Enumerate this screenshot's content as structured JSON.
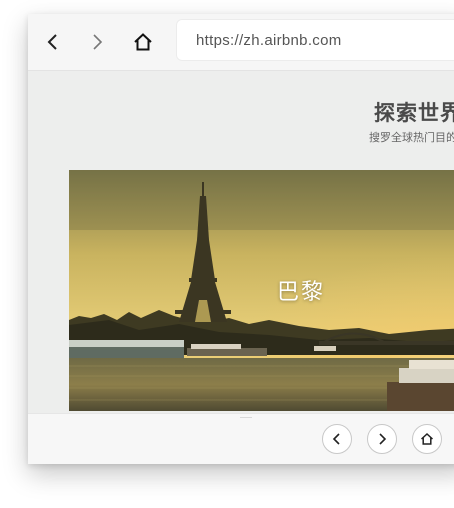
{
  "browser": {
    "url": "https://zh.airbnb.com",
    "back_icon": "chevron-left-icon",
    "forward_icon": "chevron-right-icon",
    "home_icon": "home-icon"
  },
  "page": {
    "title": "探索世界",
    "subtitle": "搜罗全球热门目的",
    "hero": {
      "label": "巴黎",
      "image": "paris-eiffel-tower-seine-sunset"
    }
  },
  "bottom_nav": {
    "prev_icon": "chevron-left-icon",
    "next_icon": "chevron-right-icon",
    "home_icon": "home-icon"
  },
  "colors": {
    "page_background": "#edeeed",
    "toolbar_background": "#f6f6f6",
    "title_text": "#4a4a4a"
  }
}
